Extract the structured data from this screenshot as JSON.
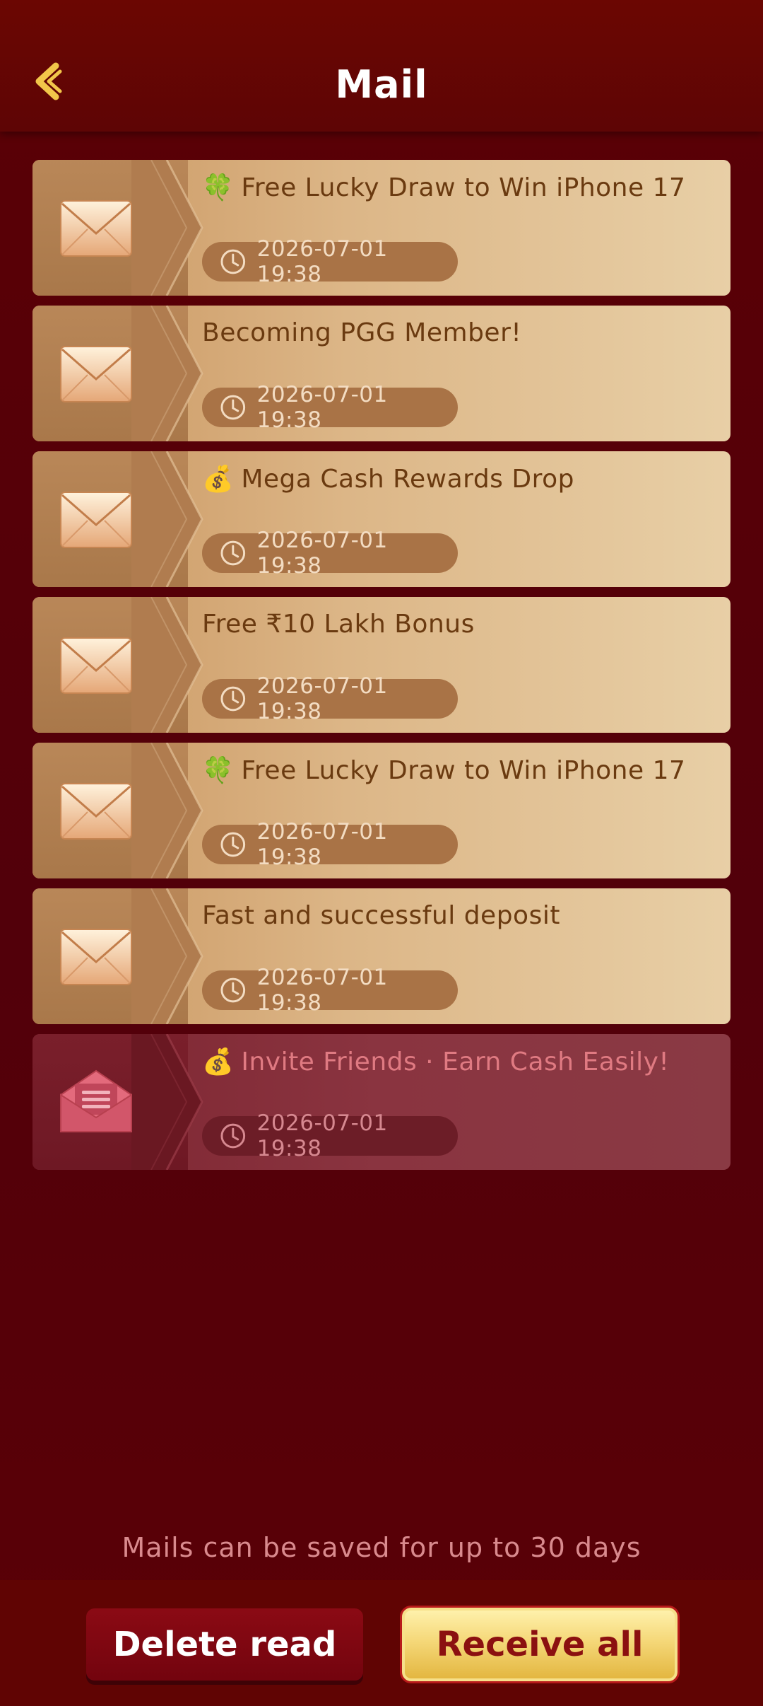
{
  "header": {
    "title": "Mail",
    "back_icon": "back-arrow-icon"
  },
  "mails": [
    {
      "emoji": "🍀",
      "title": "Free Lucky Draw to Win iPhone 17",
      "time": "2026-07-01 19:38",
      "read": false
    },
    {
      "emoji": "",
      "title": "Becoming PGG Member!",
      "time": "2026-07-01 19:38",
      "read": false
    },
    {
      "emoji": "💰",
      "title": "Mega Cash Rewards Drop",
      "time": "2026-07-01 19:38",
      "read": false
    },
    {
      "emoji": "",
      "title": "Free ₹10 Lakh Bonus",
      "time": "2026-07-01 19:38",
      "read": false
    },
    {
      "emoji": "🍀",
      "title": "Free Lucky Draw to Win iPhone 17",
      "time": "2026-07-01 19:38",
      "read": false
    },
    {
      "emoji": "",
      "title": "Fast and successful deposit",
      "time": "2026-07-01 19:38",
      "read": false
    },
    {
      "emoji": "💰",
      "title": "Invite Friends · Earn Cash Easily!",
      "time": "2026-07-01 19:38",
      "read": true
    }
  ],
  "notice": "Mails can be saved for up to 30 days",
  "footer": {
    "delete_label": "Delete read",
    "receive_label": "Receive all"
  },
  "colors": {
    "background": "#55000a",
    "card_gold": "#dcb687",
    "card_read": "#8a3440",
    "button_gold": "#f5d879"
  }
}
